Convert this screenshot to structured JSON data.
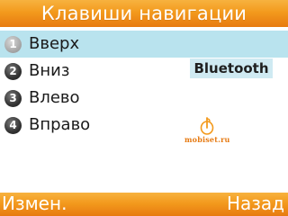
{
  "header": {
    "title": "Клавиши навигации"
  },
  "menu": {
    "items": [
      {
        "number": "1",
        "label": "Вверх",
        "selected": true
      },
      {
        "number": "2",
        "label": "Вниз",
        "selected": false
      },
      {
        "number": "3",
        "label": "Влево",
        "selected": false
      },
      {
        "number": "4",
        "label": "Вправо",
        "selected": false
      }
    ]
  },
  "assigned_value": "Bluetooth",
  "watermark": {
    "text": "mobiset.ru",
    "icon": "mobiset-logo-icon"
  },
  "softkeys": {
    "left": "Измен.",
    "right": "Назад"
  },
  "colors": {
    "accent": "#f39a1d",
    "selection": "#b9e3ee",
    "badge": "#cfeaf2"
  }
}
